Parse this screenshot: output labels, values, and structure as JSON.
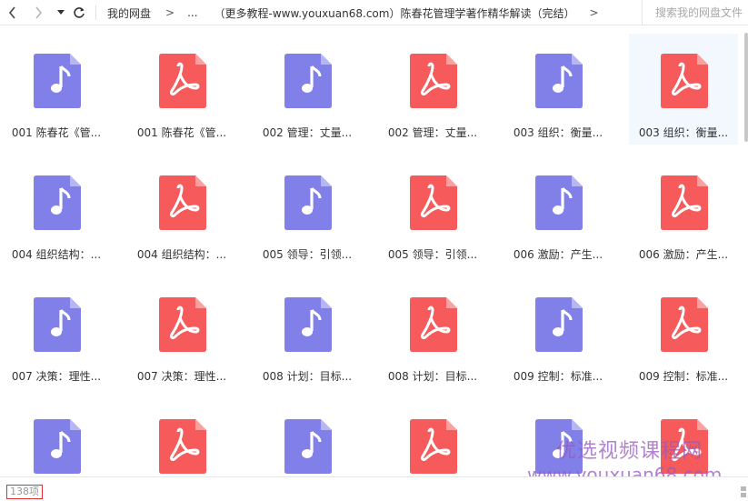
{
  "toolbar": {
    "breadcrumb": [
      "我的网盘",
      "...",
      "（更多教程-www.youxuan68.com）陈春花管理学著作精华解读（完结）"
    ],
    "separator": ">",
    "search_placeholder": "搜索我的网盘文件"
  },
  "colors": {
    "audio_icon": "#8080e8",
    "pdf_icon": "#f65a5a",
    "selected_bg": "#f2f8fe"
  },
  "files": [
    {
      "name": "001 陈春花《管...",
      "type": "audio",
      "icon": "music-note-icon"
    },
    {
      "name": "001 陈春花《管...",
      "type": "pdf",
      "icon": "pdf-icon"
    },
    {
      "name": "002 管理：丈量...",
      "type": "audio",
      "icon": "music-note-icon"
    },
    {
      "name": "002 管理：丈量...",
      "type": "pdf",
      "icon": "pdf-icon"
    },
    {
      "name": "003 组织：衡量...",
      "type": "audio",
      "icon": "music-note-icon"
    },
    {
      "name": "003 组织：衡量...",
      "type": "pdf",
      "icon": "pdf-icon",
      "selected": true
    },
    {
      "name": "004 组织结构：...",
      "type": "audio",
      "icon": "music-note-icon"
    },
    {
      "name": "004 组织结构：...",
      "type": "pdf",
      "icon": "pdf-icon"
    },
    {
      "name": "005 领导：引领...",
      "type": "audio",
      "icon": "music-note-icon"
    },
    {
      "name": "005 领导：引领...",
      "type": "pdf",
      "icon": "pdf-icon"
    },
    {
      "name": "006 激励：产生...",
      "type": "audio",
      "icon": "music-note-icon"
    },
    {
      "name": "006 激励：产生...",
      "type": "pdf",
      "icon": "pdf-icon"
    },
    {
      "name": "007 决策：理性...",
      "type": "audio",
      "icon": "music-note-icon"
    },
    {
      "name": "007 决策：理性...",
      "type": "pdf",
      "icon": "pdf-icon"
    },
    {
      "name": "008 计划：目标...",
      "type": "audio",
      "icon": "music-note-icon"
    },
    {
      "name": "008 计划：目标...",
      "type": "pdf",
      "icon": "pdf-icon"
    },
    {
      "name": "009 控制：标准...",
      "type": "audio",
      "icon": "music-note-icon"
    },
    {
      "name": "009 控制：标准...",
      "type": "pdf",
      "icon": "pdf-icon"
    },
    {
      "name": "",
      "type": "audio",
      "icon": "music-note-icon"
    },
    {
      "name": "",
      "type": "pdf",
      "icon": "pdf-icon"
    },
    {
      "name": "",
      "type": "audio",
      "icon": "music-note-icon"
    },
    {
      "name": "",
      "type": "pdf",
      "icon": "pdf-icon"
    },
    {
      "name": "",
      "type": "audio",
      "icon": "music-note-icon"
    },
    {
      "name": "",
      "type": "pdf",
      "icon": "pdf-icon"
    }
  ],
  "status": {
    "count": "138项"
  },
  "watermark": {
    "line1": "优选视频课程网",
    "line2": "www.youxuan68.com"
  }
}
